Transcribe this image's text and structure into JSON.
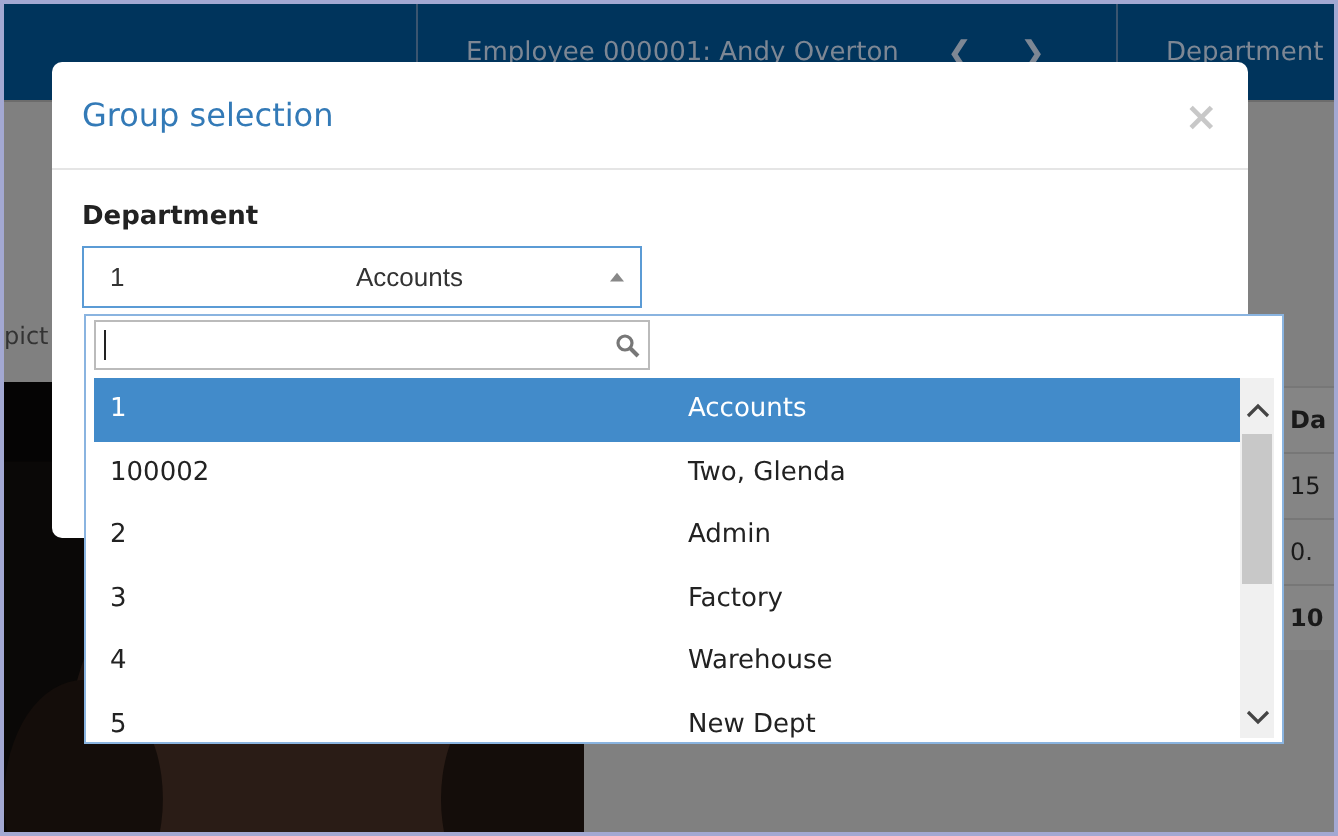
{
  "top_bar": {
    "employee": "Employee 000001: Andy Overton",
    "prev": "❮",
    "next": "❯",
    "department": "Department"
  },
  "page": {
    "picture_label": "pict",
    "table": {
      "header": "Da",
      "rows": [
        {
          "text": "15",
          "bold": false
        },
        {
          "text": "0.",
          "bold": false
        },
        {
          "text": "10",
          "bold": true
        }
      ]
    }
  },
  "dialog": {
    "title": "Group selection",
    "close": "×",
    "field_label": "Department",
    "select": {
      "code": "1",
      "name": "Accounts",
      "expanded": true
    },
    "options": [
      {
        "code": "1",
        "name": "Accounts",
        "selected": true
      },
      {
        "code": "100002",
        "name": "Two, Glenda",
        "selected": false
      },
      {
        "code": "2",
        "name": "Admin",
        "selected": false
      },
      {
        "code": "3",
        "name": "Factory",
        "selected": false
      },
      {
        "code": "4",
        "name": "Warehouse",
        "selected": false
      },
      {
        "code": "5",
        "name": "New Dept",
        "selected": false
      }
    ]
  }
}
